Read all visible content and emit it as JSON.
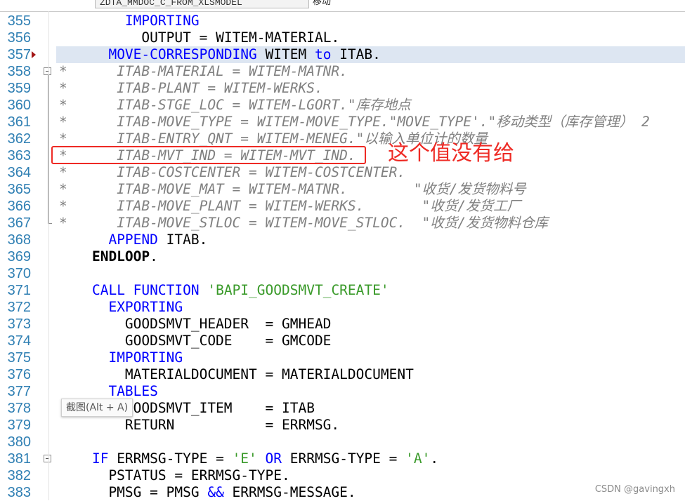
{
  "topbar": {
    "program_field": "ZDTA_MMDOC_C_FROM_XLSMODEL",
    "program_label": "移动"
  },
  "editor": {
    "current_line": "357",
    "lines": [
      {
        "num": "355",
        "segments": [
          {
            "t": "        ",
            "c": "op"
          },
          {
            "t": "IMPORTING",
            "c": "kw"
          }
        ]
      },
      {
        "num": "356",
        "segments": [
          {
            "t": "          OUTPUT ",
            "c": "op"
          },
          {
            "t": "=",
            "c": "op"
          },
          {
            "t": " WITEM",
            "c": "op"
          },
          {
            "t": "-",
            "c": "op"
          },
          {
            "t": "MATERIAL.",
            "c": "op"
          }
        ]
      },
      {
        "num": "357",
        "segments": [
          {
            "t": "      ",
            "c": "op"
          },
          {
            "t": "MOVE-CORRESPONDING",
            "c": "kw"
          },
          {
            "t": " WITEM ",
            "c": "op"
          },
          {
            "t": "to",
            "c": "kw"
          },
          {
            "t": " ITAB.",
            "c": "op"
          }
        ]
      },
      {
        "num": "358",
        "segments": [
          {
            "t": "*      ITAB-MATERIAL = WITEM-MATNR.",
            "c": "cm"
          }
        ]
      },
      {
        "num": "359",
        "segments": [
          {
            "t": "*      ITAB-PLANT = WITEM-WERKS.",
            "c": "cm"
          }
        ]
      },
      {
        "num": "360",
        "segments": [
          {
            "t": "*      ITAB-STGE_LOC = WITEM-LGORT.\"库存地点",
            "c": "cm"
          }
        ]
      },
      {
        "num": "361",
        "segments": [
          {
            "t": "*      ITAB-MOVE_TYPE = WITEM-MOVE_TYPE.\"MOVE_TYPE'.\"移动类型（库存管理） 2",
            "c": "cm"
          }
        ]
      },
      {
        "num": "362",
        "segments": [
          {
            "t": "*      ITAB-ENTRY_QNT = WITEM-MENEG.\"以输入单位计的数量",
            "c": "cm"
          }
        ]
      },
      {
        "num": "363",
        "segments": [
          {
            "t": "*      ITAB-MVT_IND = WITEM-MVT_IND.",
            "c": "cm"
          }
        ]
      },
      {
        "num": "364",
        "segments": [
          {
            "t": "*      ITAB-COSTCENTER = WITEM-COSTCENTER.",
            "c": "cm"
          }
        ]
      },
      {
        "num": "365",
        "segments": [
          {
            "t": "*      ITAB-MOVE_MAT = WITEM-MATNR.        \"收货/发货物料号",
            "c": "cm"
          }
        ]
      },
      {
        "num": "366",
        "segments": [
          {
            "t": "*      ITAB-MOVE_PLANT = WITEM-WERKS.       \"收货/发货工厂",
            "c": "cm"
          }
        ]
      },
      {
        "num": "367",
        "segments": [
          {
            "t": "*      ITAB-MOVE_STLOC = WITEM-MOVE_STLOC.  \"收货/发货物料仓库",
            "c": "cm"
          }
        ]
      },
      {
        "num": "368",
        "segments": [
          {
            "t": "      ",
            "c": "op"
          },
          {
            "t": "APPEND",
            "c": "kw"
          },
          {
            "t": " ITAB.",
            "c": "op"
          }
        ]
      },
      {
        "num": "369",
        "segments": [
          {
            "t": "    ENDLOOP",
            "c": "bold"
          },
          {
            "t": ".",
            "c": "op"
          }
        ]
      },
      {
        "num": "370",
        "segments": [
          {
            "t": "",
            "c": "op"
          }
        ]
      },
      {
        "num": "371",
        "segments": [
          {
            "t": "    ",
            "c": "op"
          },
          {
            "t": "CALL FUNCTION",
            "c": "kw"
          },
          {
            "t": " ",
            "c": "op"
          },
          {
            "t": "'BAPI_GOODSMVT_CREATE'",
            "c": "str"
          }
        ]
      },
      {
        "num": "372",
        "segments": [
          {
            "t": "      ",
            "c": "op"
          },
          {
            "t": "EXPORTING",
            "c": "kw"
          }
        ]
      },
      {
        "num": "373",
        "segments": [
          {
            "t": "        GOODSMVT_HEADER  = GMHEAD",
            "c": "op"
          }
        ]
      },
      {
        "num": "374",
        "segments": [
          {
            "t": "        GOODSMVT_CODE    = GMCODE",
            "c": "op"
          }
        ]
      },
      {
        "num": "375",
        "segments": [
          {
            "t": "      ",
            "c": "op"
          },
          {
            "t": "IMPORTING",
            "c": "kw"
          }
        ]
      },
      {
        "num": "376",
        "segments": [
          {
            "t": "        MATERIALDOCUMENT = MATERIALDOCUMENT",
            "c": "op"
          }
        ]
      },
      {
        "num": "377",
        "segments": [
          {
            "t": "      ",
            "c": "op"
          },
          {
            "t": "TABLES",
            "c": "kw"
          }
        ]
      },
      {
        "num": "378",
        "segments": [
          {
            "t": "        GOODSMVT_ITEM    = ITAB",
            "c": "op"
          }
        ]
      },
      {
        "num": "379",
        "segments": [
          {
            "t": "        RETURN           = ERRMSG.",
            "c": "op"
          }
        ]
      },
      {
        "num": "380",
        "segments": [
          {
            "t": "",
            "c": "op"
          }
        ]
      },
      {
        "num": "381",
        "segments": [
          {
            "t": "    ",
            "c": "op"
          },
          {
            "t": "IF",
            "c": "kw"
          },
          {
            "t": " ERRMSG-TYPE = ",
            "c": "op"
          },
          {
            "t": "'E'",
            "c": "str"
          },
          {
            "t": " ",
            "c": "op"
          },
          {
            "t": "OR",
            "c": "kw"
          },
          {
            "t": " ERRMSG-TYPE = ",
            "c": "op"
          },
          {
            "t": "'A'",
            "c": "str"
          },
          {
            "t": ".",
            "c": "op"
          }
        ]
      },
      {
        "num": "382",
        "segments": [
          {
            "t": "      PSTATUS = ERRMSG-TYPE.",
            "c": "op"
          }
        ]
      },
      {
        "num": "383",
        "segments": [
          {
            "t": "      PMSG = PMSG ",
            "c": "op"
          },
          {
            "t": "&&",
            "c": "kw"
          },
          {
            "t": " ERRMSG-MESSAGE.",
            "c": "op"
          }
        ]
      }
    ]
  },
  "annotation": {
    "text": "这个值没有给",
    "color": "#ee2a24"
  },
  "tooltip": {
    "text": "截图(Alt + A)"
  },
  "watermark": {
    "text": "CSDN @gavingxh"
  },
  "colors": {
    "keyword": "#0000ff",
    "string": "#3a9a2a",
    "comment": "#808080",
    "line_number": "#2f7fb3",
    "current_line_bg": "#dde6f2"
  }
}
